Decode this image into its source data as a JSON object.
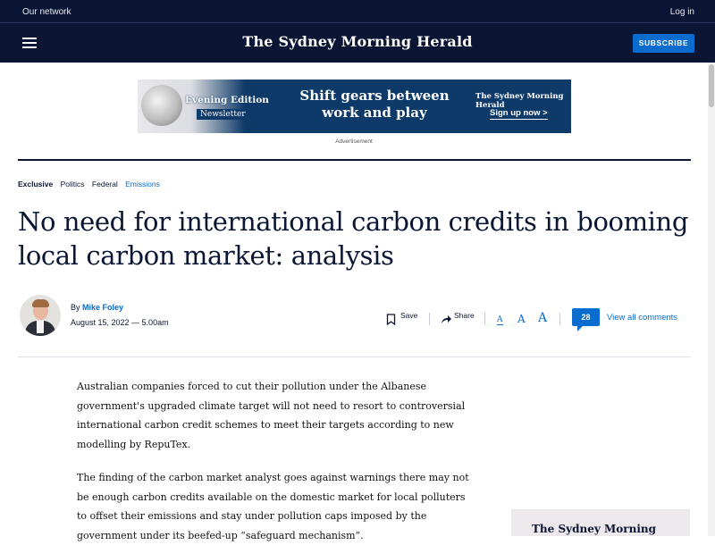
{
  "topbar": {
    "network": "Our network",
    "login": "Log in"
  },
  "navbar": {
    "masthead": "The Sydney Morning Herald",
    "subscribe": "SUBSCRIBE"
  },
  "ad": {
    "evening_title": "Evening Edition",
    "evening_badge": "Newsletter",
    "headline": "Shift gears between work and play",
    "brand": "The Sydney Morning Herald",
    "cta": "Sign up now >",
    "label": "Advertisement"
  },
  "tags": {
    "exclusive": "Exclusive",
    "politics": "Politics",
    "federal": "Federal",
    "emissions": "Emissions"
  },
  "article": {
    "headline": "No need for international carbon credits in booming local carbon market: analysis",
    "by": "By",
    "author": "Mike Foley",
    "date": "August 15, 2022 — 5.00am",
    "paragraphs": [
      "Australian companies forced to cut their pollution under the Albanese government's upgraded climate target will not need to resort to controversial international carbon credit schemes to meet their targets according to new modelling by RepuTex.",
      "The finding of the carbon market analyst goes against warnings there may not be enough carbon credits available on the domestic market for local polluters to offset their emissions and stay under pollution caps imposed by the government under its beefed-up “safeguard mechanism”."
    ]
  },
  "actions": {
    "save": "Save",
    "share": "Share",
    "font_small": "A",
    "font_medium": "A",
    "font_large": "A",
    "comment_count": "28",
    "view_all": "View all comments"
  },
  "side_ad": {
    "brand": "The Sydney Morning Herald"
  },
  "colors": {
    "navy": "#0a1633",
    "accent": "#0a6ccf"
  }
}
